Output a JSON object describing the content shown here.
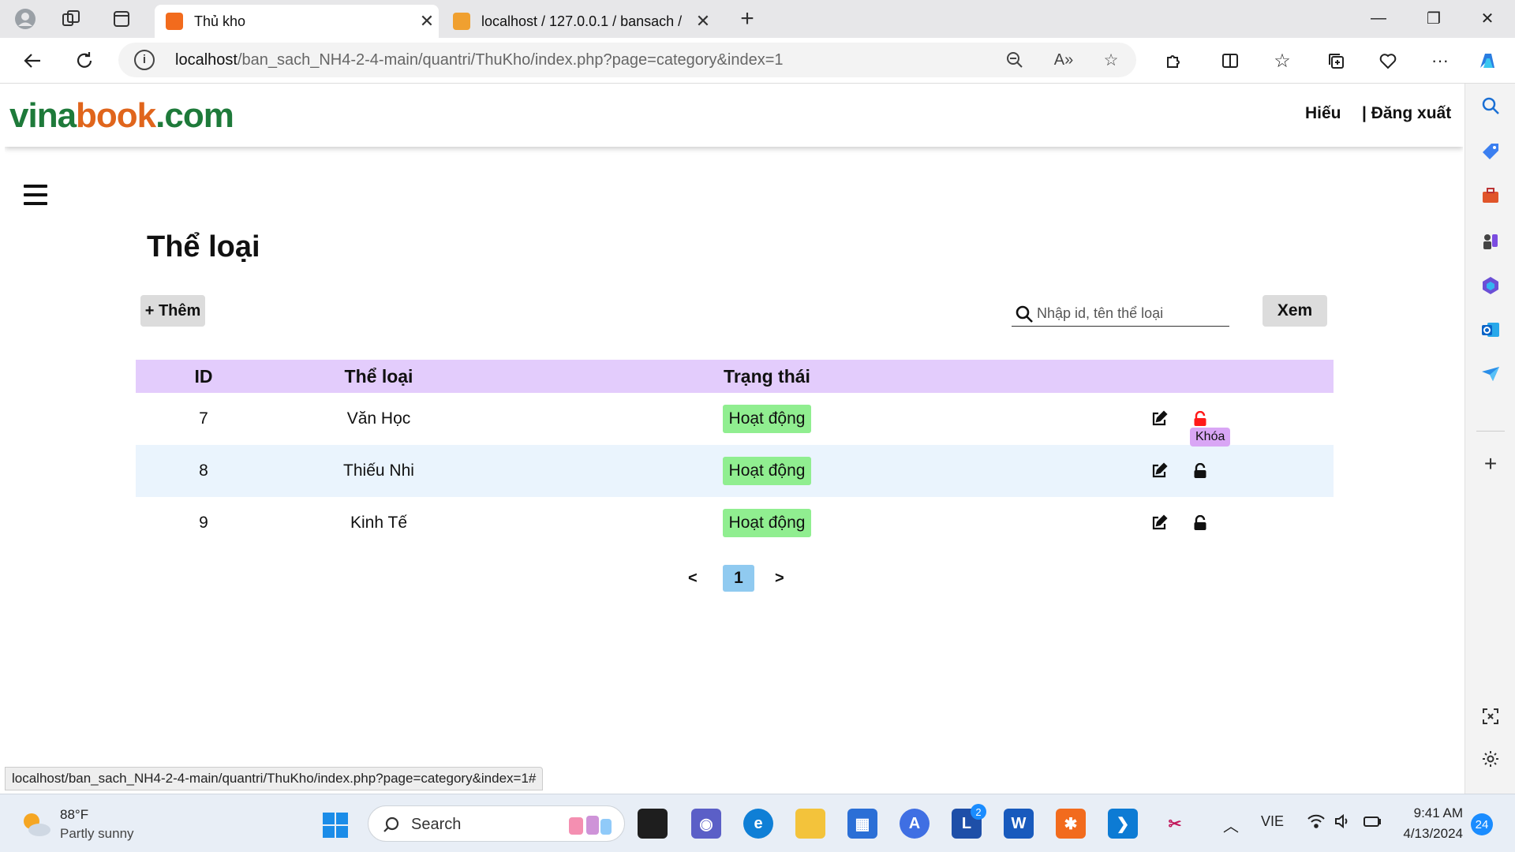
{
  "browser": {
    "tabs": [
      {
        "title": "Thủ kho",
        "active": true
      },
      {
        "title": "localhost / 127.0.0.1 / bansach /",
        "active": false
      }
    ],
    "url_host": "localhost",
    "url_path": "/ban_sach_NH4-2-4-main/quantri/ThuKho/index.php?page=category&index=1",
    "status_url": "localhost/ban_sach_NH4-2-4-main/quantri/ThuKho/index.php?page=category&index=1#"
  },
  "header": {
    "logo_part1": "vina",
    "logo_part2": "book",
    "logo_part3": ".com",
    "user": "Hiếu",
    "logout": "| Đăng xuất"
  },
  "main": {
    "title": "Thể loại",
    "add_label": "+ Thêm",
    "search_placeholder": "Nhập id, tên thể loại",
    "view_label": "Xem",
    "columns": {
      "id": "ID",
      "name": "Thể loại",
      "status": "Trạng thái"
    },
    "rows": [
      {
        "id": "7",
        "name": "Văn Học",
        "status": "Hoạt động"
      },
      {
        "id": "8",
        "name": "Thiếu Nhi",
        "status": "Hoạt động"
      },
      {
        "id": "9",
        "name": "Kinh Tế",
        "status": "Hoạt động"
      }
    ],
    "lock_tooltip": "Khóa",
    "pager": {
      "prev": "<",
      "current": "1",
      "next": ">"
    }
  },
  "taskbar": {
    "weather_temp": "88°F",
    "weather_desc": "Partly sunny",
    "search_label": "Search",
    "language": "VIE",
    "time": "9:41 AM",
    "date": "4/13/2024",
    "notification_count": "24",
    "badge_count": "2"
  },
  "colors": {
    "header_row": "#e3ccfc",
    "status_green": "#90ee90",
    "alt_row": "#eaf4fd",
    "lock_active": "#ff1a1a",
    "logo_green": "#1e7a3a",
    "logo_orange": "#e0651c"
  }
}
